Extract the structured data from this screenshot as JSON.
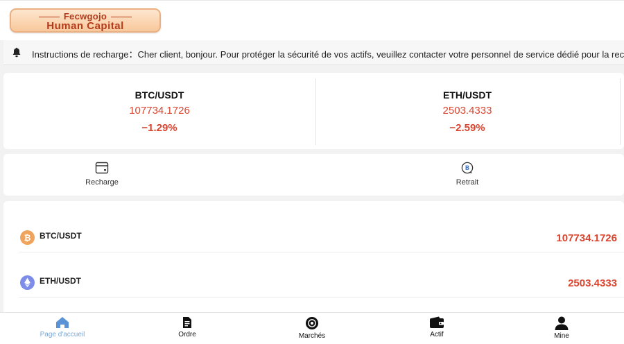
{
  "header": {
    "logo_line1": "Fecwgojo",
    "logo_line2": "Human Capital"
  },
  "notice": {
    "icon": "bell-icon",
    "text": "Instructions de recharge：Cher client, bonjour. Pour protéger la sécurité de vos actifs, veuillez contacter votre personnel de service dédié pour la recharge."
  },
  "tickers": [
    {
      "pair": "BTC/USDT",
      "price": "107734.1726",
      "change": "−1.29%"
    },
    {
      "pair": "ETH/USDT",
      "price": "2503.4333",
      "change": "−2.59%"
    }
  ],
  "actions": [
    {
      "label": "Recharge",
      "icon": "recharge-card-icon"
    },
    {
      "label": "Retrait",
      "icon": "withdraw-coin-icon"
    }
  ],
  "market": [
    {
      "pair": "BTC/USDT",
      "price": "107734.1726",
      "icon": "bitcoin-icon",
      "color": "#f0a35c"
    },
    {
      "pair": "ETH/USDT",
      "price": "2503.4333",
      "icon": "ethereum-icon",
      "color": "#7d8ce8"
    }
  ],
  "nav": [
    {
      "label": "Page d'accueil",
      "icon": "home-icon",
      "active": true
    },
    {
      "label": "Ordre",
      "icon": "order-document-icon",
      "active": false
    },
    {
      "label": "Marchés",
      "icon": "markets-icon",
      "active": false
    },
    {
      "label": "Actif",
      "icon": "wallet-icon",
      "active": false
    },
    {
      "label": "Mine",
      "icon": "user-icon",
      "active": false
    }
  ],
  "colors": {
    "accent_red": "#d9442f",
    "active_nav": "#7aa7d6",
    "logo_text": "#b43a1c"
  }
}
